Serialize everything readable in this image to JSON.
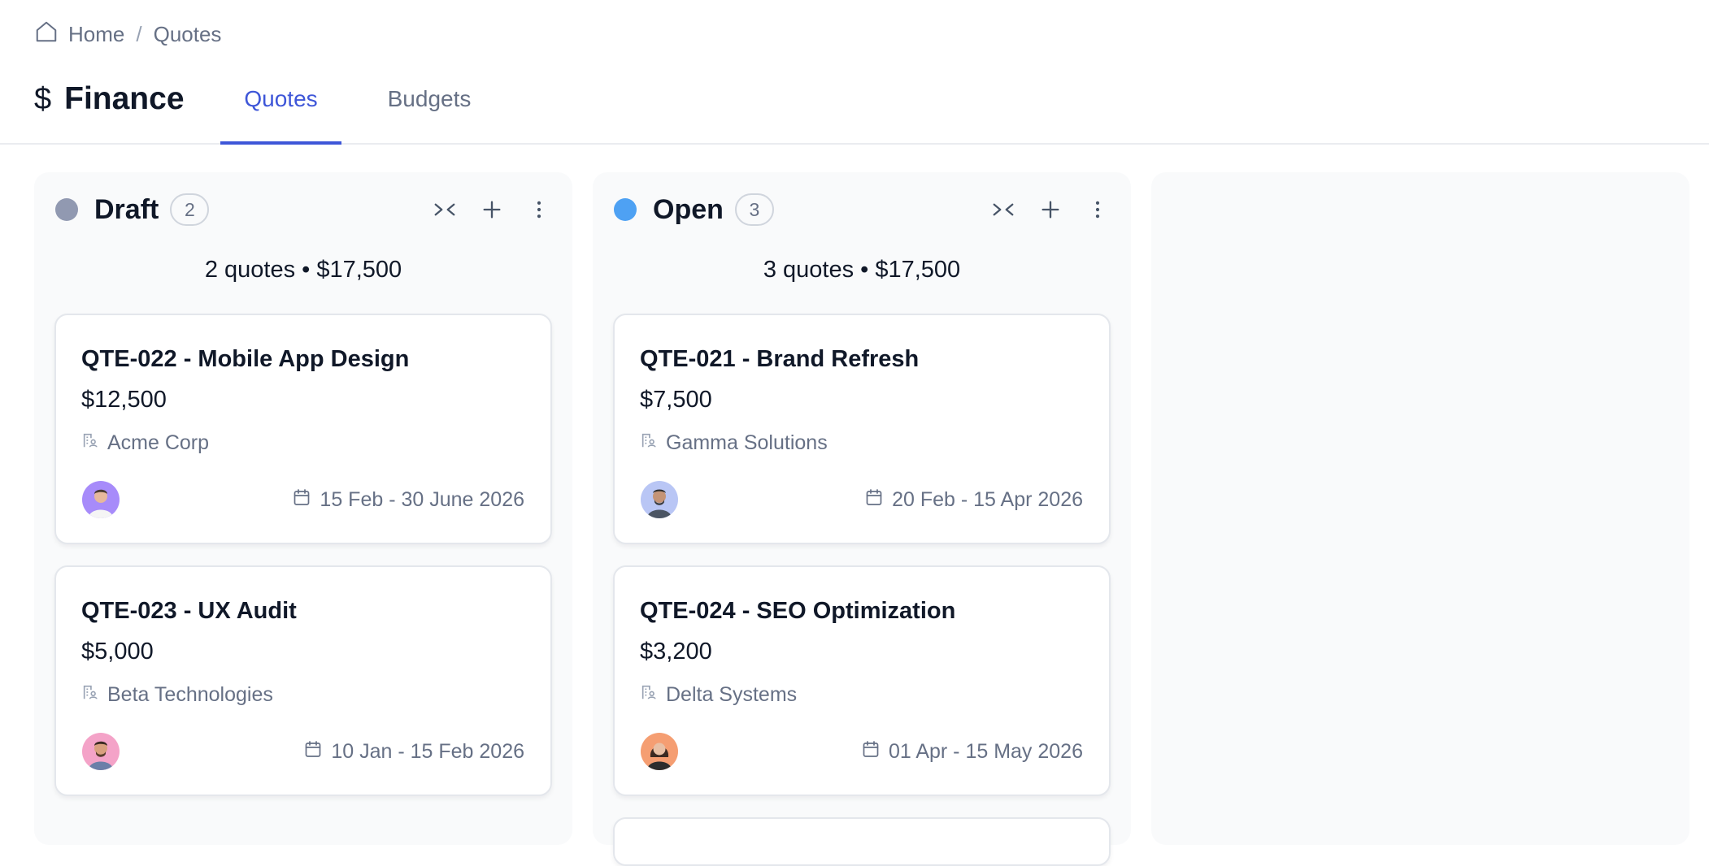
{
  "breadcrumb": {
    "home": "Home",
    "separator": "/",
    "current": "Quotes"
  },
  "header": {
    "currency_symbol": "$",
    "title": "Finance",
    "tabs": [
      {
        "label": "Quotes",
        "active": true
      },
      {
        "label": "Budgets",
        "active": false
      }
    ]
  },
  "colors": {
    "accent": "#3e56d8",
    "draft_status": "#9199b1",
    "open_status": "#4ea1f3"
  },
  "columns": [
    {
      "title": "Draft",
      "count": "2",
      "summary": "2 quotes • $17,500",
      "cards": [
        {
          "title": "QTE-022 - Mobile App Design",
          "amount": "$12,500",
          "client": "Acme Corp",
          "dates": "15 Feb - 30 June 2026",
          "avatar_bg": "#a78bfa"
        },
        {
          "title": "QTE-023 - UX Audit",
          "amount": "$5,000",
          "client": "Beta Technologies",
          "dates": "10 Jan - 15 Feb 2026",
          "avatar_bg": "#f4a3c8"
        }
      ]
    },
    {
      "title": "Open",
      "count": "3",
      "summary": "3 quotes • $17,500",
      "cards": [
        {
          "title": "QTE-021 - Brand Refresh",
          "amount": "$7,500",
          "client": "Gamma Solutions",
          "dates": "20 Feb - 15 Apr 2026",
          "avatar_bg": "#b9c6f5"
        },
        {
          "title": "QTE-024 - SEO Optimization",
          "amount": "$3,200",
          "client": "Delta Systems",
          "dates": "01 Apr - 15 May 2026",
          "avatar_bg": "#f59e72"
        }
      ]
    }
  ],
  "icons": {
    "home": "home-icon",
    "collapse": "collapse-icon",
    "add": "plus-icon",
    "more": "more-vertical-icon",
    "client": "building-user-icon",
    "calendar": "calendar-icon"
  }
}
